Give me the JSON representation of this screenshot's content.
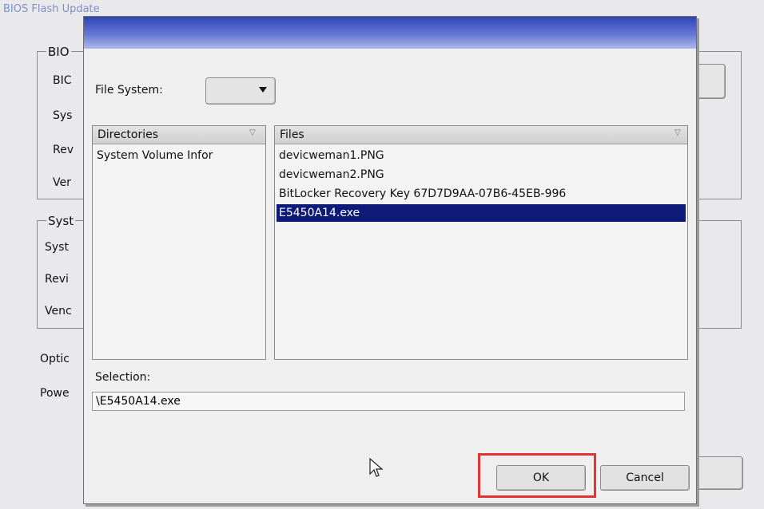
{
  "background_window": {
    "title": "BIOS Flash Update",
    "group1": {
      "legend": "BIO",
      "labels": [
        "BIC",
        "Sys",
        "Rev",
        "Ver"
      ]
    },
    "group2": {
      "legend": "Syst",
      "labels": [
        "Syst",
        "Revi",
        "Venc"
      ]
    },
    "other_labels": [
      "Optic",
      "Powe"
    ]
  },
  "dialog": {
    "file_system": {
      "label": "File System:",
      "value": ""
    },
    "directories": {
      "header": "Directories",
      "items": [
        "System Volume Infor"
      ]
    },
    "files": {
      "header": "Files",
      "items": [
        "devicweman1.PNG",
        "devicweman2.PNG",
        "BitLocker Recovery Key 67D7D9AA-07B6-45EB-996",
        "E5450A14.exe"
      ],
      "selected_index": 3
    },
    "selection": {
      "label": "Selection:",
      "value": "\\E5450A14.exe"
    },
    "buttons": {
      "ok": "OK",
      "cancel": "Cancel"
    }
  },
  "colors": {
    "selection_bg": "#0d1a78",
    "titlebar": "#3a50c0",
    "highlight": "#e23636"
  },
  "icons": [
    "filter-icon",
    "chevron-down-icon",
    "mouse-cursor-icon"
  ]
}
